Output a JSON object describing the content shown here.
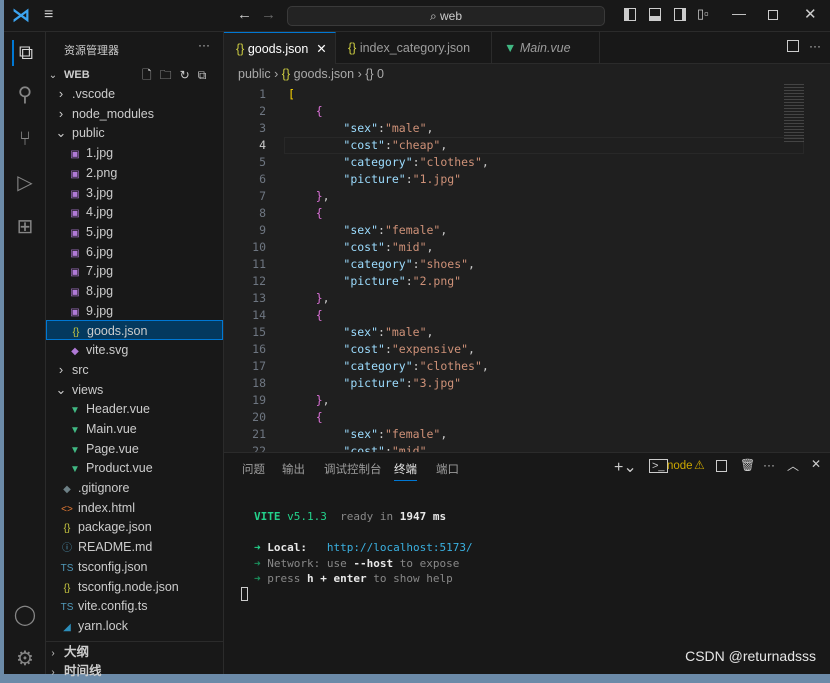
{
  "titlebar": {
    "search": "web",
    "search_icon": "search-icon"
  },
  "sidebar": {
    "title": "资源管理器",
    "root": "WEB",
    "items": [
      {
        "label": ".vscode",
        "type": "folder",
        "depth": 1,
        "open": false
      },
      {
        "label": "node_modules",
        "type": "folder",
        "depth": 1,
        "open": false
      },
      {
        "label": "public",
        "type": "folder",
        "depth": 1,
        "open": true
      },
      {
        "label": "1.jpg",
        "type": "image",
        "depth": 2
      },
      {
        "label": "2.png",
        "type": "image",
        "depth": 2
      },
      {
        "label": "3.jpg",
        "type": "image",
        "depth": 2
      },
      {
        "label": "4.jpg",
        "type": "image",
        "depth": 2
      },
      {
        "label": "5.jpg",
        "type": "image",
        "depth": 2
      },
      {
        "label": "6.jpg",
        "type": "image",
        "depth": 2
      },
      {
        "label": "7.jpg",
        "type": "image",
        "depth": 2
      },
      {
        "label": "8.jpg",
        "type": "image",
        "depth": 2
      },
      {
        "label": "9.jpg",
        "type": "image",
        "depth": 2
      },
      {
        "label": "goods.json",
        "type": "json",
        "depth": 2,
        "selected": true
      },
      {
        "label": "vite.svg",
        "type": "svg",
        "depth": 2
      },
      {
        "label": "src",
        "type": "folder",
        "depth": 1,
        "open": false
      },
      {
        "label": "views",
        "type": "folder",
        "depth": 1,
        "open": true
      },
      {
        "label": "Header.vue",
        "type": "vue",
        "depth": 2
      },
      {
        "label": "Main.vue",
        "type": "vue",
        "depth": 2
      },
      {
        "label": "Page.vue",
        "type": "vue",
        "depth": 2
      },
      {
        "label": "Product.vue",
        "type": "vue",
        "depth": 2
      },
      {
        "label": ".gitignore",
        "type": "git",
        "depth": 1
      },
      {
        "label": "index.html",
        "type": "html",
        "depth": 1
      },
      {
        "label": "package.json",
        "type": "json",
        "depth": 1
      },
      {
        "label": "README.md",
        "type": "md",
        "depth": 1
      },
      {
        "label": "tsconfig.json",
        "type": "ts",
        "depth": 1
      },
      {
        "label": "tsconfig.node.json",
        "type": "json",
        "depth": 1
      },
      {
        "label": "vite.config.ts",
        "type": "ts",
        "depth": 1
      },
      {
        "label": "yarn.lock",
        "type": "yarn",
        "depth": 1
      }
    ],
    "sections": [
      "大纲",
      "时间线"
    ]
  },
  "tabs": [
    {
      "label": "goods.json",
      "active": true
    },
    {
      "label": "index_category.json"
    },
    {
      "label": "Main.vue",
      "italic": true
    }
  ],
  "breadcrumb": [
    "public",
    "goods.json",
    "{} 0"
  ],
  "editor": {
    "current_line": 4,
    "lines": [
      "[",
      "    {",
      "        \"sex\":\"male\",",
      "        \"cost\":\"cheap\",",
      "        \"category\":\"clothes\",",
      "        \"picture\":\"1.jpg\"",
      "    },",
      "    {",
      "        \"sex\":\"female\",",
      "        \"cost\":\"mid\",",
      "        \"category\":\"shoes\",",
      "        \"picture\":\"2.png\"",
      "    },",
      "    {",
      "        \"sex\":\"male\",",
      "        \"cost\":\"expensive\",",
      "        \"category\":\"clothes\",",
      "        \"picture\":\"3.jpg\"",
      "    },",
      "    {",
      "        \"sex\":\"female\",",
      "        \"cost\":\"mid\","
    ]
  },
  "panel": {
    "tabs": [
      "问题",
      "输出",
      "调试控制台",
      "终端",
      "端口"
    ],
    "active_tab": "终端",
    "terminal_name": "node",
    "terminal": {
      "vite": "VITE",
      "version": "v5.1.3",
      "ready": "ready in",
      "ms_value": "1947",
      "ms": "ms",
      "local_label": "Local:",
      "local_url": "http://localhost:5173/",
      "network": "Network: use",
      "host": "--host",
      "expose": "to expose",
      "press": "press",
      "h": "h",
      "plus": "+",
      "enter": "enter",
      "help": "to show help",
      "arrow": "➜"
    }
  },
  "watermark": "CSDN @returnadsss"
}
